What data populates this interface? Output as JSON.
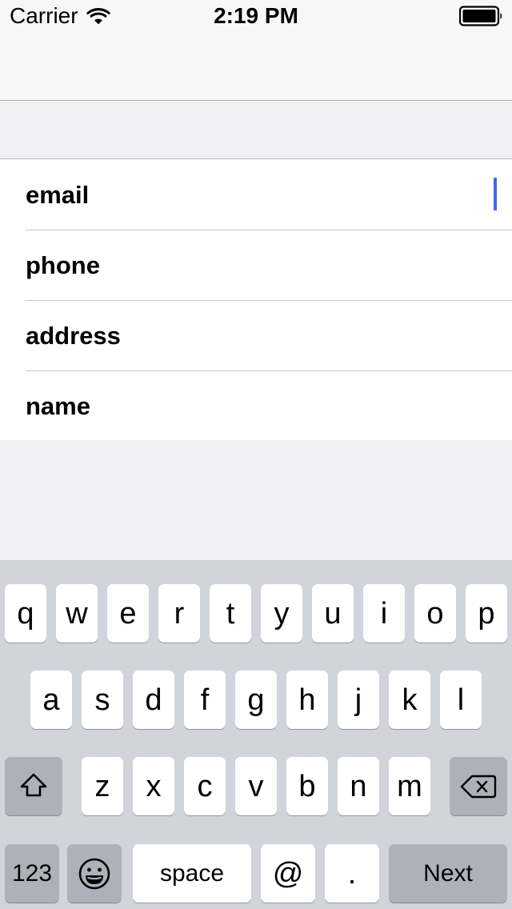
{
  "status_bar": {
    "carrier": "Carrier",
    "wifi_icon": "wifi-icon",
    "time": "2:19 PM",
    "battery_icon": "battery-full-icon"
  },
  "nav_bar": {
    "title": ""
  },
  "form": {
    "rows": [
      {
        "label": "email",
        "focused": true,
        "value": ""
      },
      {
        "label": "phone",
        "focused": false,
        "value": ""
      },
      {
        "label": "address",
        "focused": false,
        "value": ""
      },
      {
        "label": "name",
        "focused": false,
        "value": ""
      }
    ],
    "caret_color": "#4169E8"
  },
  "keyboard": {
    "type": "email-address",
    "background_color": "#D1D4DB",
    "key_color": "#FFFFFF",
    "modifier_key_color": "#ADB1BA",
    "row1": [
      {
        "label": "q"
      },
      {
        "label": "w"
      },
      {
        "label": "e"
      },
      {
        "label": "r"
      },
      {
        "label": "t"
      },
      {
        "label": "y"
      },
      {
        "label": "u"
      },
      {
        "label": "i"
      },
      {
        "label": "o"
      },
      {
        "label": "p"
      }
    ],
    "row2": [
      {
        "label": "a"
      },
      {
        "label": "s"
      },
      {
        "label": "d"
      },
      {
        "label": "f"
      },
      {
        "label": "g"
      },
      {
        "label": "h"
      },
      {
        "label": "j"
      },
      {
        "label": "k"
      },
      {
        "label": "l"
      }
    ],
    "row3": {
      "shift": {
        "icon": "shift-icon",
        "label": ""
      },
      "letters": [
        {
          "label": "z"
        },
        {
          "label": "x"
        },
        {
          "label": "c"
        },
        {
          "label": "v"
        },
        {
          "label": "b"
        },
        {
          "label": "n"
        },
        {
          "label": "m"
        }
      ],
      "backspace": {
        "icon": "delete-left-icon",
        "label": ""
      }
    },
    "row4": {
      "numeric": {
        "label": "123"
      },
      "emoji": {
        "icon": "emoji-smiley-icon",
        "label": ""
      },
      "space": {
        "label": "space"
      },
      "at": {
        "label": "@"
      },
      "period": {
        "label": "."
      },
      "return": {
        "label": "Next"
      }
    }
  }
}
